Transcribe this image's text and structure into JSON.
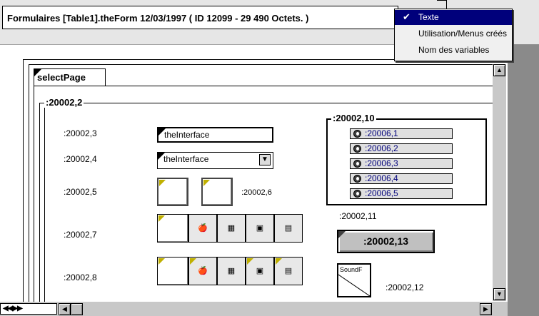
{
  "title": "Formulaires [Table1].theForm  12/03/1997 ( ID 12099 - 29 490 Octets. )",
  "menu": {
    "items": [
      {
        "label": "Texte",
        "checked": true
      },
      {
        "label": "Utilisation/Menus créés",
        "checked": false
      },
      {
        "label": "Nom des variables",
        "checked": false
      }
    ],
    "check_glyph": "✔"
  },
  "form": {
    "tab_label": "selectPage",
    "group_main": ":20002,2",
    "group_radio": ":20002,10",
    "fields": {
      "f3": ":20002,3",
      "f4": ":20002,4",
      "f5": ":20002,5",
      "f6": ":20002,6",
      "f7": ":20002,7",
      "f8": ":20002,8",
      "f11": ":20002,11",
      "f12": ":20002,12"
    },
    "textbox_value": "theInterface",
    "dropdown_value": "theInterface",
    "radios": [
      ":20006,1",
      ":20006,2",
      ":20006,3",
      ":20006,4",
      ":20006,5"
    ],
    "button_label": ":20002,13",
    "sound_label": "SoundF"
  },
  "scroll": {
    "nav_arrows": "◀◀▶▶",
    "left_arrow": "◀",
    "right_arrow": "▶",
    "up_arrow": "▲",
    "down_arrow": "▼"
  },
  "colors": {
    "menu_highlight": "#00007b",
    "corner_accent": "#c0b000"
  }
}
